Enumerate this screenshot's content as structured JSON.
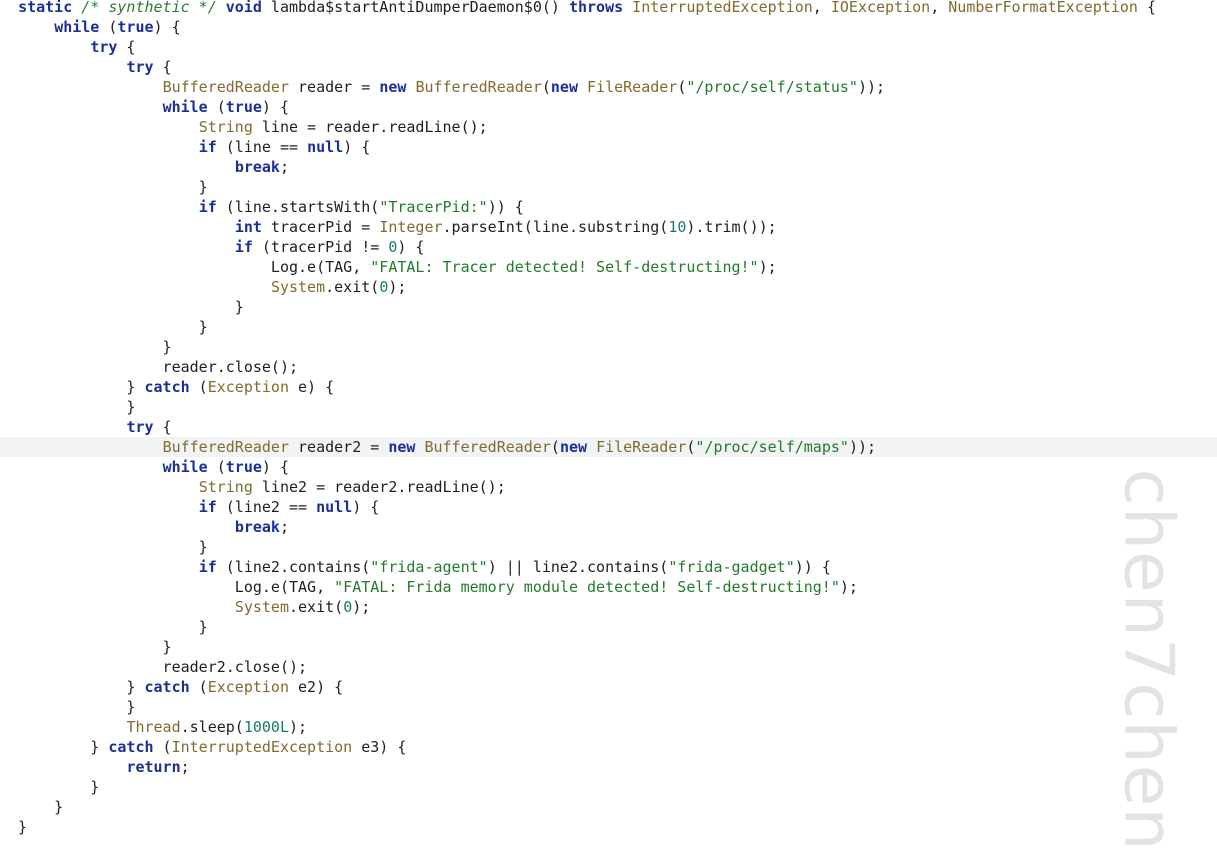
{
  "editor": {
    "current_line": 22,
    "lines": [
      [
        [
          "  ",
          "tx"
        ],
        [
          "static",
          "kw"
        ],
        [
          " ",
          "tx"
        ],
        [
          "/* synthetic */",
          "cm"
        ],
        [
          " ",
          "tx"
        ],
        [
          "void",
          "kw"
        ],
        [
          " lambda$startAntiDumperDaemon$0() ",
          "tx"
        ],
        [
          "throws",
          "kw"
        ],
        [
          " ",
          "tx"
        ],
        [
          "InterruptedException",
          "ty"
        ],
        [
          ", ",
          "tx"
        ],
        [
          "IOException",
          "ty"
        ],
        [
          ", ",
          "tx"
        ],
        [
          "NumberFormatException",
          "ty"
        ],
        [
          " {",
          "tx"
        ]
      ],
      [
        [
          "      ",
          "tx"
        ],
        [
          "while",
          "kw"
        ],
        [
          " (",
          "tx"
        ],
        [
          "true",
          "kw"
        ],
        [
          ") {",
          "tx"
        ]
      ],
      [
        [
          "          ",
          "tx"
        ],
        [
          "try",
          "kw"
        ],
        [
          " {",
          "tx"
        ]
      ],
      [
        [
          "              ",
          "tx"
        ],
        [
          "try",
          "kw"
        ],
        [
          " {",
          "tx"
        ]
      ],
      [
        [
          "                  ",
          "tx"
        ],
        [
          "BufferedReader",
          "ty"
        ],
        [
          " reader = ",
          "tx"
        ],
        [
          "new",
          "kw"
        ],
        [
          " ",
          "tx"
        ],
        [
          "BufferedReader",
          "ty"
        ],
        [
          "(",
          "tx"
        ],
        [
          "new",
          "kw"
        ],
        [
          " ",
          "tx"
        ],
        [
          "FileReader",
          "ty"
        ],
        [
          "(",
          "tx"
        ],
        [
          "\"/proc/self/status\"",
          "st"
        ],
        [
          "));",
          "tx"
        ]
      ],
      [
        [
          "                  ",
          "tx"
        ],
        [
          "while",
          "kw"
        ],
        [
          " (",
          "tx"
        ],
        [
          "true",
          "kw"
        ],
        [
          ") {",
          "tx"
        ]
      ],
      [
        [
          "                      ",
          "tx"
        ],
        [
          "String",
          "ty"
        ],
        [
          " line = reader.readLine();",
          "tx"
        ]
      ],
      [
        [
          "                      ",
          "tx"
        ],
        [
          "if",
          "kw"
        ],
        [
          " (line == ",
          "tx"
        ],
        [
          "null",
          "kw"
        ],
        [
          ") {",
          "tx"
        ]
      ],
      [
        [
          "                          ",
          "tx"
        ],
        [
          "break",
          "kw"
        ],
        [
          ";",
          "tx"
        ]
      ],
      [
        [
          "                      }",
          "tx"
        ]
      ],
      [
        [
          "                      ",
          "tx"
        ],
        [
          "if",
          "kw"
        ],
        [
          " (line.startsWith(",
          "tx"
        ],
        [
          "\"TracerPid:\"",
          "st"
        ],
        [
          ")) {",
          "tx"
        ]
      ],
      [
        [
          "                          ",
          "tx"
        ],
        [
          "int",
          "kw"
        ],
        [
          " tracerPid = ",
          "tx"
        ],
        [
          "Integer",
          "ty"
        ],
        [
          ".parseInt(line.substring(",
          "tx"
        ],
        [
          "10",
          "nm"
        ],
        [
          ").trim());",
          "tx"
        ]
      ],
      [
        [
          "                          ",
          "tx"
        ],
        [
          "if",
          "kw"
        ],
        [
          " (tracerPid != ",
          "tx"
        ],
        [
          "0",
          "nm"
        ],
        [
          ") {",
          "tx"
        ]
      ],
      [
        [
          "                              Log.e(TAG, ",
          "tx"
        ],
        [
          "\"FATAL: Tracer detected! Self-destructing!\"",
          "st"
        ],
        [
          ");",
          "tx"
        ]
      ],
      [
        [
          "                              ",
          "tx"
        ],
        [
          "System",
          "ty"
        ],
        [
          ".exit(",
          "tx"
        ],
        [
          "0",
          "nm"
        ],
        [
          ");",
          "tx"
        ]
      ],
      [
        [
          "                          }",
          "tx"
        ]
      ],
      [
        [
          "                      }",
          "tx"
        ]
      ],
      [
        [
          "                  }",
          "tx"
        ]
      ],
      [
        [
          "                  reader.close();",
          "tx"
        ]
      ],
      [
        [
          "              } ",
          "tx"
        ],
        [
          "catch",
          "kw"
        ],
        [
          " (",
          "tx"
        ],
        [
          "Exception",
          "ty"
        ],
        [
          " e) {",
          "tx"
        ]
      ],
      [
        [
          "              }",
          "tx"
        ]
      ],
      [
        [
          "              ",
          "tx"
        ],
        [
          "try",
          "kw"
        ],
        [
          " {",
          "tx"
        ]
      ],
      [
        [
          "                  ",
          "tx"
        ],
        [
          "BufferedReader",
          "ty"
        ],
        [
          " reader2 = ",
          "tx"
        ],
        [
          "new",
          "kw"
        ],
        [
          " ",
          "tx"
        ],
        [
          "BufferedReader",
          "ty"
        ],
        [
          "(",
          "tx"
        ],
        [
          "new",
          "kw"
        ],
        [
          " ",
          "tx"
        ],
        [
          "FileReader",
          "ty"
        ],
        [
          "(",
          "tx"
        ],
        [
          "\"/proc/self/maps\"",
          "st"
        ],
        [
          "));",
          "tx"
        ]
      ],
      [
        [
          "                  ",
          "tx"
        ],
        [
          "while",
          "kw"
        ],
        [
          " (",
          "tx"
        ],
        [
          "true",
          "kw"
        ],
        [
          ") {",
          "tx"
        ]
      ],
      [
        [
          "                      ",
          "tx"
        ],
        [
          "String",
          "ty"
        ],
        [
          " line2 = reader2.readLine();",
          "tx"
        ]
      ],
      [
        [
          "                      ",
          "tx"
        ],
        [
          "if",
          "kw"
        ],
        [
          " (line2 == ",
          "tx"
        ],
        [
          "null",
          "kw"
        ],
        [
          ") {",
          "tx"
        ]
      ],
      [
        [
          "                          ",
          "tx"
        ],
        [
          "break",
          "kw"
        ],
        [
          ";",
          "tx"
        ]
      ],
      [
        [
          "                      }",
          "tx"
        ]
      ],
      [
        [
          "                      ",
          "tx"
        ],
        [
          "if",
          "kw"
        ],
        [
          " (line2.contains(",
          "tx"
        ],
        [
          "\"frida-agent\"",
          "st"
        ],
        [
          ") || line2.contains(",
          "tx"
        ],
        [
          "\"frida-gadget\"",
          "st"
        ],
        [
          ")) {",
          "tx"
        ]
      ],
      [
        [
          "                          Log.e(TAG, ",
          "tx"
        ],
        [
          "\"FATAL: Frida memory module detected! Self-destructing!\"",
          "st"
        ],
        [
          ");",
          "tx"
        ]
      ],
      [
        [
          "                          ",
          "tx"
        ],
        [
          "System",
          "ty"
        ],
        [
          ".exit(",
          "tx"
        ],
        [
          "0",
          "nm"
        ],
        [
          ");",
          "tx"
        ]
      ],
      [
        [
          "                      }",
          "tx"
        ]
      ],
      [
        [
          "                  }",
          "tx"
        ]
      ],
      [
        [
          "                  reader2.close();",
          "tx"
        ]
      ],
      [
        [
          "              } ",
          "tx"
        ],
        [
          "catch",
          "kw"
        ],
        [
          " (",
          "tx"
        ],
        [
          "Exception",
          "ty"
        ],
        [
          " e2) {",
          "tx"
        ]
      ],
      [
        [
          "              }",
          "tx"
        ]
      ],
      [
        [
          "              ",
          "tx"
        ],
        [
          "Thread",
          "ty"
        ],
        [
          ".sleep(",
          "tx"
        ],
        [
          "1000L",
          "nm"
        ],
        [
          ");",
          "tx"
        ]
      ],
      [
        [
          "          } ",
          "tx"
        ],
        [
          "catch",
          "kw"
        ],
        [
          " (",
          "tx"
        ],
        [
          "InterruptedException",
          "ty"
        ],
        [
          " e3) {",
          "tx"
        ]
      ],
      [
        [
          "              ",
          "tx"
        ],
        [
          "return",
          "kw"
        ],
        [
          ";",
          "tx"
        ]
      ],
      [
        [
          "          }",
          "tx"
        ]
      ],
      [
        [
          "      }",
          "tx"
        ]
      ],
      [
        [
          "  }",
          "tx"
        ]
      ]
    ]
  },
  "watermark": "chen7chen"
}
